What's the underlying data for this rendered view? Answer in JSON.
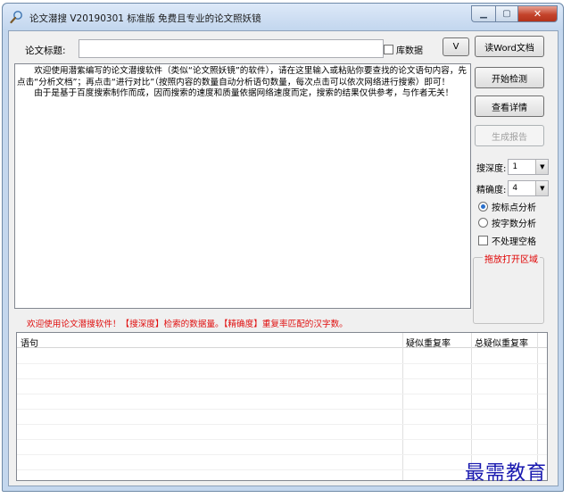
{
  "window": {
    "title": "论文潜搜 V20190301 标准版 免费且专业的论文照妖镜"
  },
  "top": {
    "title_label": "论文标题:",
    "title_value": "",
    "checkbox_label": "库数据",
    "checkbox_checked": false,
    "v_button": "V"
  },
  "main_text": {
    "paragraph1": "欢迎使用潜紫编写的论文潜搜软件（类似“论文照妖镜”的软件），请在这里输入或粘贴你要查找的论文语句内容，先点击“分析文档”；再点击“进行对比”（按照内容的数量自动分析语句数量，每次点击可以依次网络进行搜索）即可！",
    "paragraph2": "由于是基于百度搜索制作而成，因而搜索的速度和质量依据网络速度而定，搜索的结果仅供参考，与作者无关！"
  },
  "side": {
    "read_word": "读Word文档",
    "start_check": "开始检测",
    "view_detail": "查看详情",
    "gen_report": "生成报告",
    "depth_label": "搜深度:",
    "depth_value": "1",
    "precision_label": "精确度:",
    "precision_value": "4",
    "opt_punct": "按标点分析",
    "opt_chars": "按字数分析",
    "opt_no_space": "不处理空格",
    "drop_area": "拖放打开区域"
  },
  "status": {
    "welcome": "欢迎使用论文潜搜软件！【搜深度】检索的数据量。【精确度】重复率匹配的汉字数。"
  },
  "table": {
    "headers": [
      "语句",
      "疑似重复率",
      "总疑似重复率"
    ]
  },
  "watermark": "最需教育",
  "colors": {
    "accent_red": "#e01010",
    "title_bar": "#c4d7ee",
    "watermark_blue": "#1a1ab0"
  }
}
